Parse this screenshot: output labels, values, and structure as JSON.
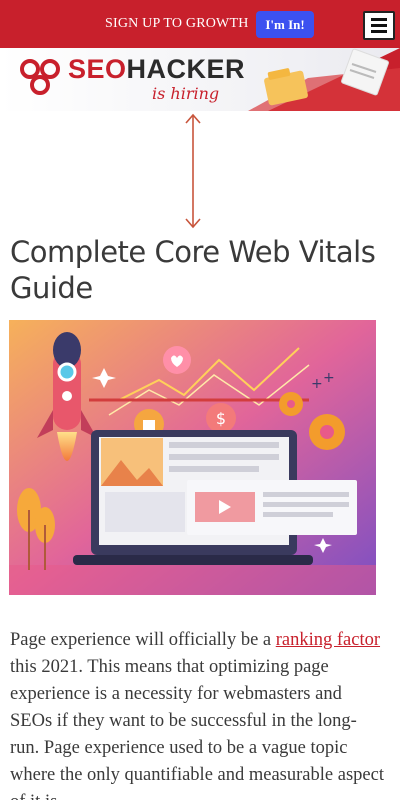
{
  "topbar": {
    "signup_text": "SIGN UP TO GROWTH",
    "cta_label": "I'm In!",
    "menu_icon": "hamburger-menu-icon"
  },
  "banner": {
    "logo_seo": "SEO",
    "logo_hacker": "HACKER",
    "tagline": "is hiring"
  },
  "article": {
    "title": "Complete Core Web Vitals Guide",
    "body_before_link": "Page experience will officially be a ",
    "link_text": "ranking factor",
    "body_after_link": " this 2021. This means that optimizing page experience is a necessity for webmasters and SEOs if they want to be successful in the long-run. Page experience used to be a vague topic where the only quantifiable and measurable aspect of it is"
  },
  "colors": {
    "brand_red": "#c8202c",
    "cta_blue": "#3c51f0",
    "text": "#3a3a3a"
  }
}
